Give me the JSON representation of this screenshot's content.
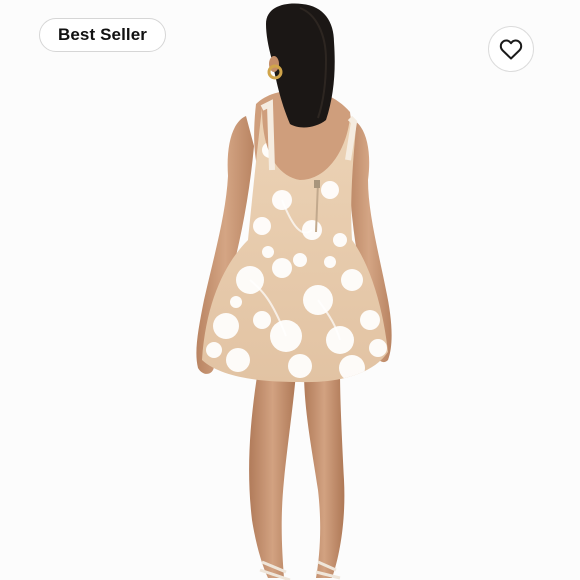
{
  "listing": {
    "badge_label": "Best Seller",
    "favorite_icon": "heart-outline-icon",
    "image_subject": "product-photo-floral-mini-dress-back-view"
  },
  "colors": {
    "background": "#fcfcfc",
    "badge_text": "#111111",
    "badge_border": "#d6d6d6",
    "heart_stroke": "#1a1a1a",
    "dress_base": "#e8ccae",
    "dress_flower": "#ffffff",
    "skin": "#c99878",
    "hair": "#1b1715"
  }
}
